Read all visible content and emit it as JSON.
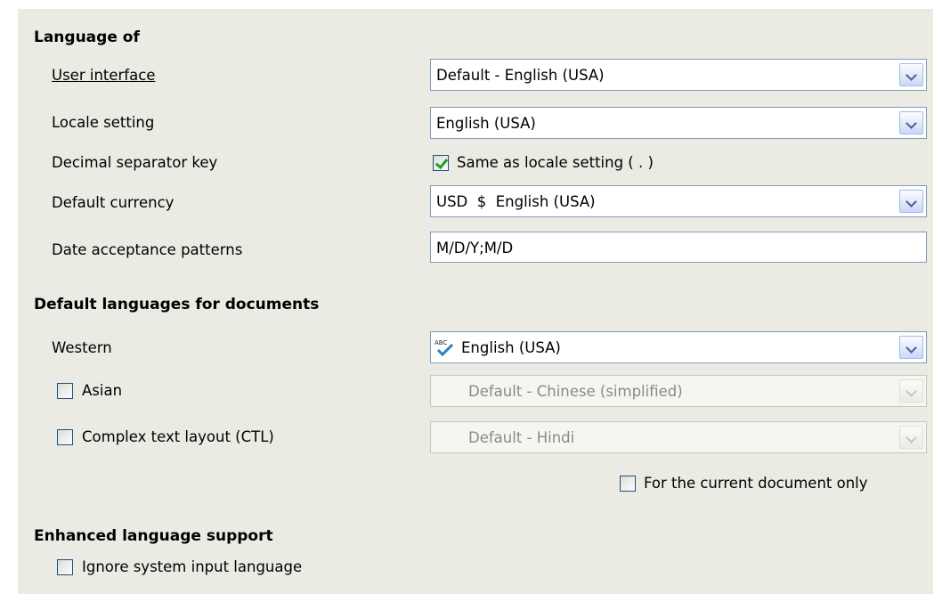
{
  "language_of": {
    "heading": "Language of",
    "user_interface": {
      "label": "User interface",
      "value": "Default - English (USA)"
    },
    "locale_setting": {
      "label": "Locale setting",
      "value": "English (USA)"
    },
    "decimal_separator": {
      "label": "Decimal separator key",
      "checkbox_label": "Same as locale setting ( . )",
      "checked": true
    },
    "default_currency": {
      "label": "Default currency",
      "value": "USD  $  English (USA)"
    },
    "date_patterns": {
      "label": "Date acceptance patterns",
      "value": "M/D/Y;M/D"
    }
  },
  "default_languages": {
    "heading": "Default languages for documents",
    "western": {
      "label": "Western",
      "value": "English (USA)",
      "icon": "spellcheck-icon"
    },
    "asian": {
      "label": "Asian",
      "value": "Default - Chinese (simplified)",
      "checked": false
    },
    "ctl": {
      "label": "Complex text layout (CTL)",
      "value": "Default - Hindi",
      "checked": false
    },
    "current_doc_only": {
      "label": "For the current document only",
      "checked": false
    }
  },
  "enhanced": {
    "heading": "Enhanced language support",
    "ignore_input": {
      "label": "Ignore system input language",
      "checked": false
    }
  },
  "colors": {
    "panel": "#ebebe4",
    "field_border": "#7f9db9",
    "check_green": "#21a121"
  }
}
